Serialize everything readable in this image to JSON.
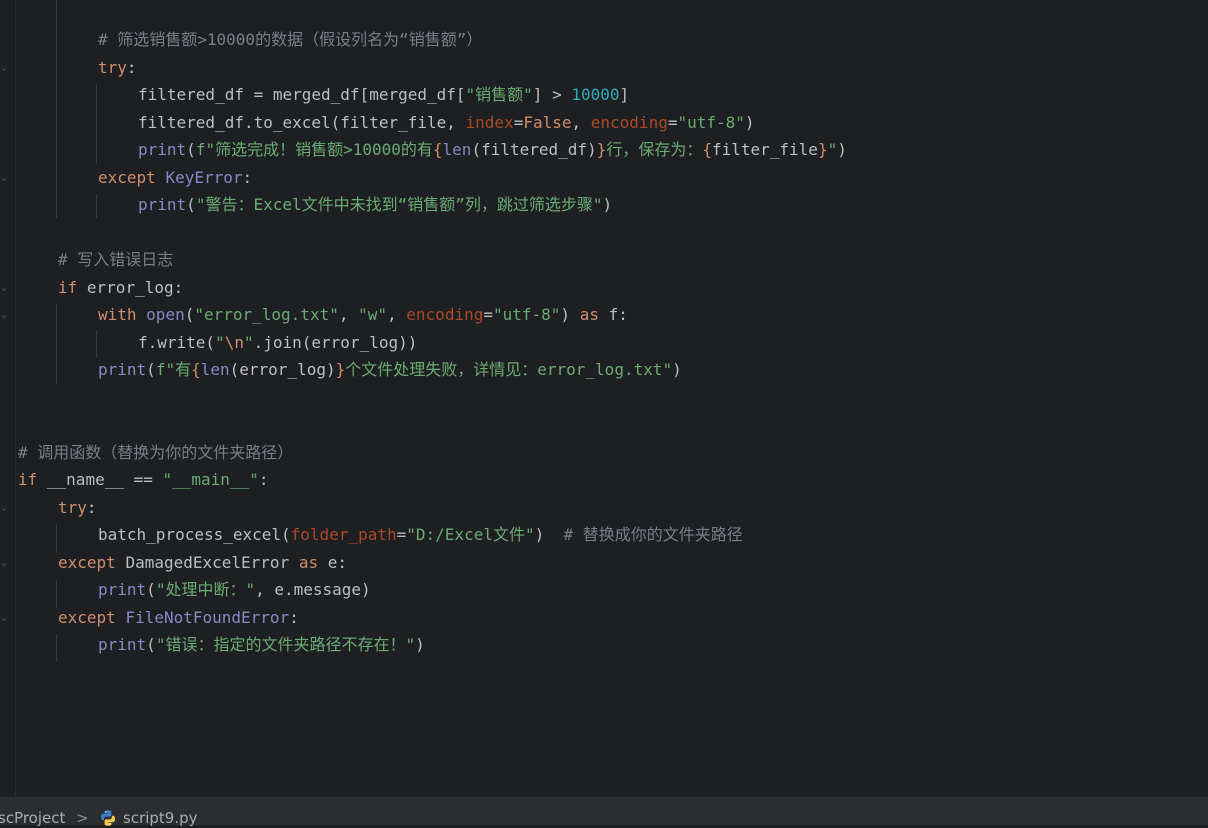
{
  "editor": {
    "lines": [
      {
        "indent": 80,
        "spans": [
          {
            "c": "cmt",
            "t": "# 筛选销售额>10000的数据（假设列名为“销售额”）"
          }
        ]
      },
      {
        "indent": 80,
        "spans": [
          {
            "c": "kw",
            "t": "try"
          },
          {
            "c": "plain",
            "t": ":"
          }
        ]
      },
      {
        "indent": 120,
        "spans": [
          {
            "c": "plain",
            "t": "filtered_df = merged_df[merged_df["
          },
          {
            "c": "str",
            "t": "\"销售额\""
          },
          {
            "c": "plain",
            "t": "] > "
          },
          {
            "c": "num",
            "t": "10000"
          },
          {
            "c": "plain",
            "t": "]"
          }
        ]
      },
      {
        "indent": 120,
        "spans": [
          {
            "c": "plain",
            "t": "filtered_df.to_excel(filter_file, "
          },
          {
            "c": "param",
            "t": "index"
          },
          {
            "c": "plain",
            "t": "="
          },
          {
            "c": "kw",
            "t": "False"
          },
          {
            "c": "plain",
            "t": ", "
          },
          {
            "c": "param",
            "t": "encoding"
          },
          {
            "c": "plain",
            "t": "="
          },
          {
            "c": "str",
            "t": "\"utf-8\""
          },
          {
            "c": "plain",
            "t": ")"
          }
        ]
      },
      {
        "indent": 120,
        "spans": [
          {
            "c": "bi",
            "t": "print"
          },
          {
            "c": "plain",
            "t": "("
          },
          {
            "c": "str",
            "t": "f\"筛选完成！销售额>10000的有"
          },
          {
            "c": "fb",
            "t": "{"
          },
          {
            "c": "bi",
            "t": "len"
          },
          {
            "c": "plain",
            "t": "(filtered_df)"
          },
          {
            "c": "fb",
            "t": "}"
          },
          {
            "c": "str",
            "t": "行，保存为："
          },
          {
            "c": "fb",
            "t": "{"
          },
          {
            "c": "plain",
            "t": "filter_file"
          },
          {
            "c": "fb",
            "t": "}"
          },
          {
            "c": "str",
            "t": "\""
          },
          {
            "c": "plain",
            "t": ")"
          }
        ]
      },
      {
        "indent": 80,
        "spans": [
          {
            "c": "kw",
            "t": "except "
          },
          {
            "c": "bi",
            "t": "KeyError"
          },
          {
            "c": "plain",
            "t": ":"
          }
        ]
      },
      {
        "indent": 120,
        "spans": [
          {
            "c": "bi",
            "t": "print"
          },
          {
            "c": "plain",
            "t": "("
          },
          {
            "c": "str",
            "t": "\"警告：Excel文件中未找到“销售额”列，跳过筛选步骤\""
          },
          {
            "c": "plain",
            "t": ")"
          }
        ]
      },
      {
        "indent": 0,
        "spans": []
      },
      {
        "indent": 40,
        "spans": [
          {
            "c": "cmt",
            "t": "# 写入错误日志"
          }
        ]
      },
      {
        "indent": 40,
        "spans": [
          {
            "c": "kw",
            "t": "if "
          },
          {
            "c": "plain",
            "t": "error_log:"
          }
        ]
      },
      {
        "indent": 80,
        "spans": [
          {
            "c": "kw",
            "t": "with "
          },
          {
            "c": "bi",
            "t": "open"
          },
          {
            "c": "plain",
            "t": "("
          },
          {
            "c": "str",
            "t": "\"error_log.txt\""
          },
          {
            "c": "plain",
            "t": ", "
          },
          {
            "c": "str",
            "t": "\"w\""
          },
          {
            "c": "plain",
            "t": ", "
          },
          {
            "c": "param",
            "t": "encoding"
          },
          {
            "c": "plain",
            "t": "="
          },
          {
            "c": "str",
            "t": "\"utf-8\""
          },
          {
            "c": "plain",
            "t": ") "
          },
          {
            "c": "kw",
            "t": "as "
          },
          {
            "c": "plain",
            "t": "f:"
          }
        ]
      },
      {
        "indent": 120,
        "spans": [
          {
            "c": "plain",
            "t": "f.write("
          },
          {
            "c": "str",
            "t": "\""
          },
          {
            "c": "esc",
            "t": "\\n"
          },
          {
            "c": "str",
            "t": "\""
          },
          {
            "c": "plain",
            "t": ".join(error_log))"
          }
        ]
      },
      {
        "indent": 80,
        "spans": [
          {
            "c": "bi",
            "t": "print"
          },
          {
            "c": "plain",
            "t": "("
          },
          {
            "c": "str",
            "t": "f\"有"
          },
          {
            "c": "fb",
            "t": "{"
          },
          {
            "c": "bi",
            "t": "len"
          },
          {
            "c": "plain",
            "t": "(error_log)"
          },
          {
            "c": "fb",
            "t": "}"
          },
          {
            "c": "str",
            "t": "个文件处理失败，详情见：error_log.txt\""
          },
          {
            "c": "plain",
            "t": ")"
          }
        ]
      },
      {
        "indent": 0,
        "spans": []
      },
      {
        "indent": 0,
        "spans": []
      },
      {
        "indent": 0,
        "spans": [
          {
            "c": "cmt",
            "t": "# 调用函数（替换为你的文件夹路径）"
          }
        ]
      },
      {
        "indent": 0,
        "spans": [
          {
            "c": "kw",
            "t": "if "
          },
          {
            "c": "plain",
            "t": "__name__ == "
          },
          {
            "c": "str",
            "t": "\"__main__\""
          },
          {
            "c": "plain",
            "t": ":"
          }
        ]
      },
      {
        "indent": 40,
        "spans": [
          {
            "c": "kw",
            "t": "try"
          },
          {
            "c": "plain",
            "t": ":"
          }
        ]
      },
      {
        "indent": 80,
        "spans": [
          {
            "c": "plain",
            "t": "batch_process_excel("
          },
          {
            "c": "param",
            "t": "folder_path"
          },
          {
            "c": "plain",
            "t": "="
          },
          {
            "c": "str",
            "t": "\"D:/Excel文件\""
          },
          {
            "c": "plain",
            "t": ")  "
          },
          {
            "c": "cmt",
            "t": "# 替换成你的文件夹路径"
          }
        ]
      },
      {
        "indent": 40,
        "spans": [
          {
            "c": "kw",
            "t": "except "
          },
          {
            "c": "plain",
            "t": "DamagedExcelError "
          },
          {
            "c": "kw",
            "t": "as "
          },
          {
            "c": "plain",
            "t": "e:"
          }
        ]
      },
      {
        "indent": 80,
        "spans": [
          {
            "c": "bi",
            "t": "print"
          },
          {
            "c": "plain",
            "t": "("
          },
          {
            "c": "str",
            "t": "\"处理中断：\""
          },
          {
            "c": "plain",
            "t": ", e.message)"
          }
        ]
      },
      {
        "indent": 40,
        "spans": [
          {
            "c": "kw",
            "t": "except "
          },
          {
            "c": "bi",
            "t": "FileNotFoundError"
          },
          {
            "c": "plain",
            "t": ":"
          }
        ]
      },
      {
        "indent": 80,
        "spans": [
          {
            "c": "bi",
            "t": "print"
          },
          {
            "c": "plain",
            "t": "("
          },
          {
            "c": "str",
            "t": "\"错误：指定的文件夹路径不存在！\""
          },
          {
            "c": "plain",
            "t": ")"
          }
        ]
      }
    ]
  },
  "statusbar": {
    "project": "scProject",
    "separator": ">",
    "file": "script9.py",
    "file_icon": "python-file-icon"
  }
}
